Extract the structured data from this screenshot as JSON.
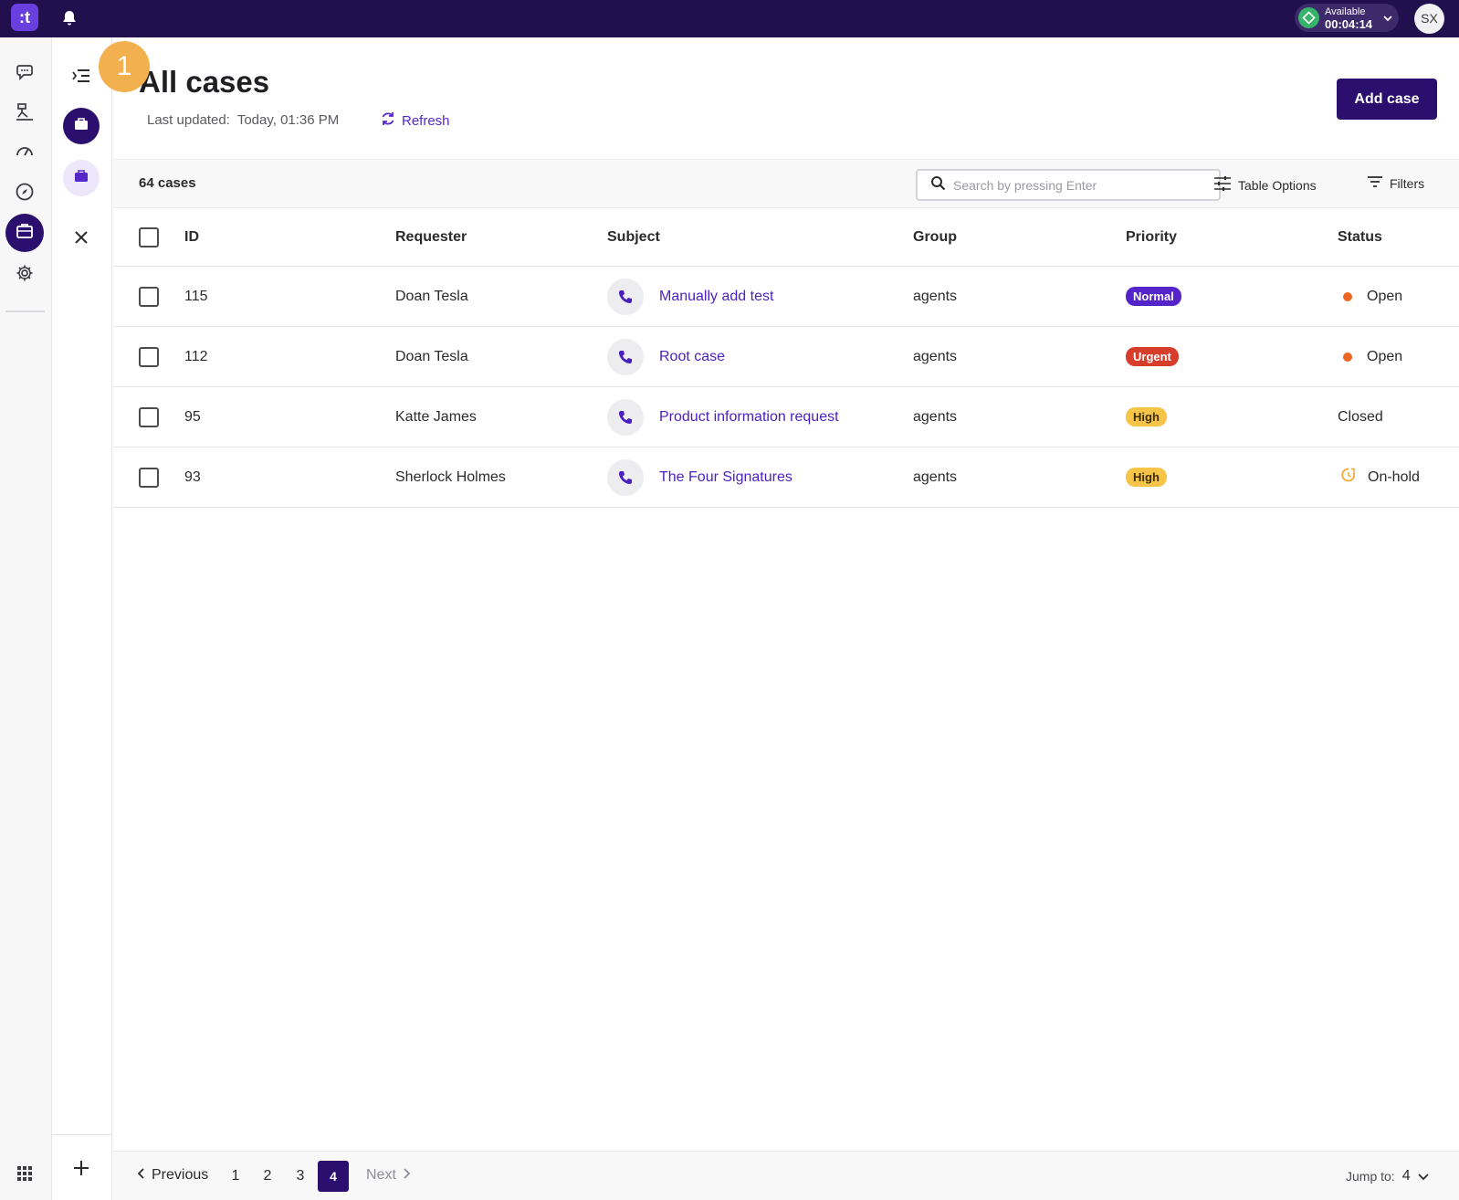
{
  "topbar": {
    "logo_text": ":t",
    "status_label": "Available",
    "status_time": "00:04:14",
    "avatar_initials": "SX",
    "status_color": "#35b36a"
  },
  "step_badge": "1",
  "header": {
    "title": "All cases",
    "last_updated_label": "Last updated:",
    "last_updated_value": "Today, 01:36 PM",
    "refresh_label": "Refresh",
    "add_case_label": "Add case"
  },
  "toolbar": {
    "case_count": "64 cases",
    "search_placeholder": "Search by pressing Enter",
    "table_options_label": "Table Options",
    "filters_label": "Filters"
  },
  "table": {
    "columns": [
      "ID",
      "Requester",
      "Subject",
      "Group",
      "Priority",
      "Status"
    ],
    "rows": [
      {
        "id": "115",
        "requester": "Doan Tesla",
        "subject": "Manually add test",
        "group": "agents",
        "priority": "Normal",
        "status": "Open"
      },
      {
        "id": "112",
        "requester": "Doan Tesla",
        "subject": "Root case",
        "group": "agents",
        "priority": "Urgent",
        "status": "Open"
      },
      {
        "id": "95",
        "requester": "Katte James",
        "subject": "Product information request",
        "group": "agents",
        "priority": "High",
        "status": "Closed"
      },
      {
        "id": "93",
        "requester": "Sherlock Holmes",
        "subject": "The Four Signatures",
        "group": "agents",
        "priority": "High",
        "status": "On-hold"
      }
    ]
  },
  "pagination": {
    "previous_label": "Previous",
    "pages": [
      "1",
      "2",
      "3",
      "4"
    ],
    "current_page": "4",
    "next_label": "Next",
    "jump_label": "Jump to:",
    "jump_value": "4"
  },
  "colors": {
    "brand_dark": "#2a0f6e",
    "topbar": "#22104e",
    "accent": "#5427c9",
    "priority_normal": "#5423c9",
    "priority_urgent": "#d63d2a",
    "priority_high": "#f6c447",
    "status_open": "#ee6624"
  },
  "icons": {
    "rail": [
      "chat-bubble-icon",
      "flow-icon",
      "speedometer-icon",
      "compass-icon",
      "briefcase-icon",
      "gear-icon",
      "grid-icon"
    ],
    "subnav": [
      "menu-collapse-icon",
      "briefcase-icon",
      "briefcase-icon",
      "close-icon",
      "plus-icon"
    ]
  }
}
